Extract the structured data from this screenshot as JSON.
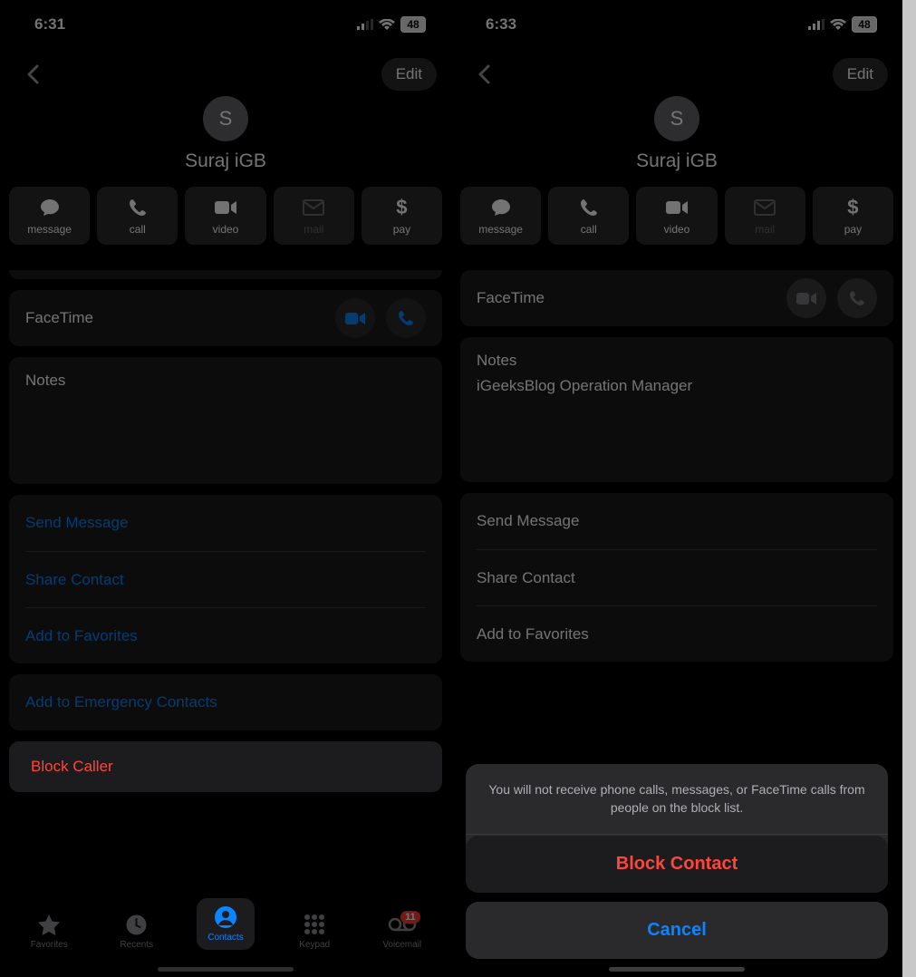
{
  "left": {
    "status": {
      "time": "6:31",
      "battery": "48"
    },
    "header": {
      "edit": "Edit",
      "avatar_initial": "S",
      "name": "Suraj iGB"
    },
    "actions": {
      "message": "message",
      "call": "call",
      "video": "video",
      "mail": "mail",
      "pay": "pay"
    },
    "facetime": {
      "label": "FaceTime"
    },
    "notes": {
      "label": "Notes"
    },
    "links": {
      "send_message": "Send Message",
      "share_contact": "Share Contact",
      "add_favorites": "Add to Favorites",
      "add_emergency": "Add to Emergency Contacts"
    },
    "block": "Block Caller",
    "tabs": {
      "favorites": "Favorites",
      "recents": "Recents",
      "contacts": "Contacts",
      "keypad": "Keypad",
      "voicemail": "Voicemail",
      "voicemail_badge": "11"
    }
  },
  "right": {
    "status": {
      "time": "6:33",
      "battery": "48"
    },
    "header": {
      "edit": "Edit",
      "avatar_initial": "S",
      "name": "Suraj iGB"
    },
    "actions": {
      "message": "message",
      "call": "call",
      "video": "video",
      "mail": "mail",
      "pay": "pay"
    },
    "facetime": {
      "label": "FaceTime"
    },
    "notes": {
      "label": "Notes",
      "text": "iGeeksBlog Operation Manager"
    },
    "links": {
      "send_message": "Send Message",
      "share_contact": "Share Contact",
      "add_favorites": "Add to Favorites"
    },
    "sheet": {
      "message": "You will not receive phone calls, messages, or FaceTime calls from people on the block list.",
      "block": "Block Contact",
      "cancel": "Cancel"
    }
  }
}
